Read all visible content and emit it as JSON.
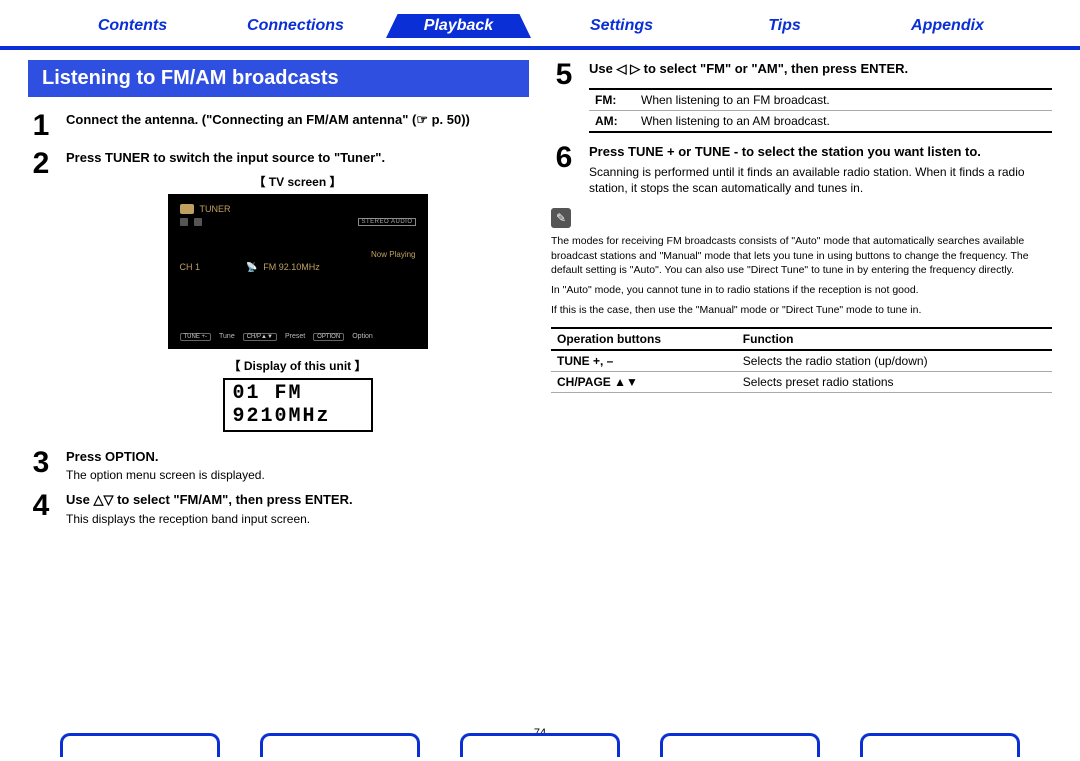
{
  "nav": {
    "contents": "Contents",
    "connections": "Connections",
    "playback": "Playback",
    "settings": "Settings",
    "tips": "Tips",
    "appendix": "Appendix"
  },
  "section_title": "Listening to FM/AM broadcasts",
  "steps": {
    "s1": {
      "num": "1",
      "head": "Connect the antenna. (\"Connecting an FM/AM antenna\" (☞ p. 50))"
    },
    "s2": {
      "num": "2",
      "head": "Press TUNER to switch the input source to \"Tuner\"."
    },
    "s3": {
      "num": "3",
      "head": "Press OPTION.",
      "sub": "The option menu screen is displayed."
    },
    "s4": {
      "num": "4",
      "head": "Use △▽ to select \"FM/AM\", then press ENTER.",
      "sub": "This displays the reception band input screen."
    },
    "s5": {
      "num": "5",
      "head": "Use ◁ ▷ to select \"FM\" or \"AM\", then press ENTER."
    },
    "s6": {
      "num": "6",
      "head": "Press TUNE + or TUNE - to select the station you want listen to.",
      "sub": "Scanning is performed until it finds an available radio station. When it finds a radio station, it stops the scan automatically and tunes in."
    }
  },
  "tv": {
    "label": "【 TV screen 】",
    "tuner": "TUNER",
    "stereo": "STEREO  AUDIO",
    "now": "Now Playing",
    "ch": "CH 1",
    "freq": "FM 92.10MHz",
    "btn_tune": "TUNE +-",
    "lbl_tune": "Tune",
    "btn_ch": "CH/P▲▼",
    "lbl_preset": "Preset",
    "btn_opt": "OPTION",
    "lbl_opt": "Option"
  },
  "unit": {
    "label": "【 Display of this unit 】",
    "line1": "01 FM",
    "line2": " 9210MHz"
  },
  "fm_am_table": {
    "fm_h": "FM:",
    "fm_v": "When listening to an FM broadcast.",
    "am_h": "AM:",
    "am_v": "When listening to an AM broadcast."
  },
  "notes": {
    "p1": "The modes for receiving FM broadcasts consists of \"Auto\" mode that automatically searches available broadcast stations and \"Manual\" mode that lets you tune in using buttons to change the frequency. The default setting is \"Auto\". You can also use \"Direct Tune\" to tune in by entering the frequency directly.",
    "p2": "In \"Auto\" mode, you cannot tune in to radio stations if the reception is not good.",
    "p3": "If this is the case, then use the \"Manual\" mode or \"Direct Tune\" mode to tune in."
  },
  "op_table": {
    "h1": "Operation buttons",
    "h2": "Function",
    "r1c1": "TUNE +, –",
    "r1c2": "Selects the radio station (up/down)",
    "r2c1": "CH/PAGE ▲▼",
    "r2c2": "Selects preset radio stations"
  },
  "page_number": "74"
}
